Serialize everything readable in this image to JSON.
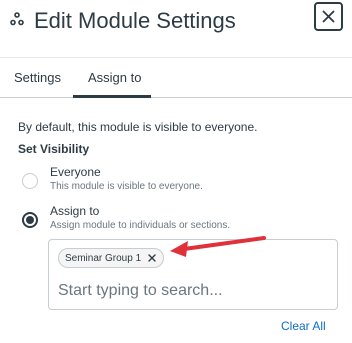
{
  "header": {
    "title": "Edit Module Settings",
    "module_icon": "module-icon",
    "close_icon": "close-icon"
  },
  "tabs": [
    {
      "label": "Settings",
      "selected": false
    },
    {
      "label": "Assign to",
      "selected": true
    }
  ],
  "body": {
    "intro": "By default, this module is visible to everyone.",
    "section_label": "Set Visibility",
    "options": [
      {
        "title": "Everyone",
        "description": "This module is visible to everyone.",
        "checked": false
      },
      {
        "title": "Assign to",
        "description": "Assign module to individuals or sections.",
        "checked": true
      }
    ],
    "assign_box": {
      "chips": [
        {
          "label": "Seminar Group 1",
          "remove_icon": "close-icon"
        }
      ],
      "search": {
        "value": "",
        "placeholder": "Start typing to search..."
      }
    },
    "clear_all_label": "Clear All"
  },
  "colors": {
    "text": "#2d3b45",
    "muted": "#6b7780",
    "border": "#c7cdd1",
    "link": "#0b6bcb",
    "annotation_arrow": "#e0313a"
  }
}
